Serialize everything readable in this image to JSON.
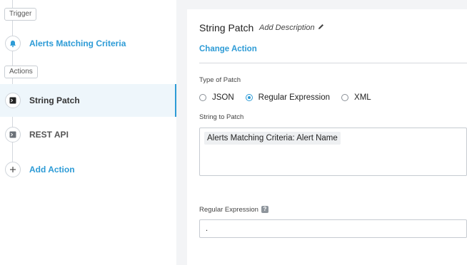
{
  "sidebar": {
    "trigger_label": "Trigger",
    "actions_label": "Actions",
    "trigger_step": {
      "label": "Alerts Matching Criteria",
      "icon": "bell-icon"
    },
    "action_steps": [
      {
        "label": "String Patch",
        "icon": "terminal-icon",
        "active": true
      },
      {
        "label": "REST API",
        "icon": "terminal-icon",
        "active": false
      }
    ],
    "add_action": {
      "label": "Add Action",
      "icon": "plus-icon"
    }
  },
  "editor": {
    "title": "String Patch",
    "add_description": "Add Description",
    "change_action": "Change Action",
    "patch_type": {
      "label": "Type of Patch",
      "options": [
        "JSON",
        "Regular Expression",
        "XML"
      ],
      "selected": "Regular Expression"
    },
    "string_to_patch": {
      "label": "String to Patch",
      "token": "Alerts Matching Criteria: Alert Name"
    },
    "regex": {
      "label": "Regular Expression",
      "help": "?",
      "value": "."
    }
  },
  "colors": {
    "accent": "#2d9bd6",
    "background": "#f3f4f6",
    "active_row": "#eef6fb"
  }
}
